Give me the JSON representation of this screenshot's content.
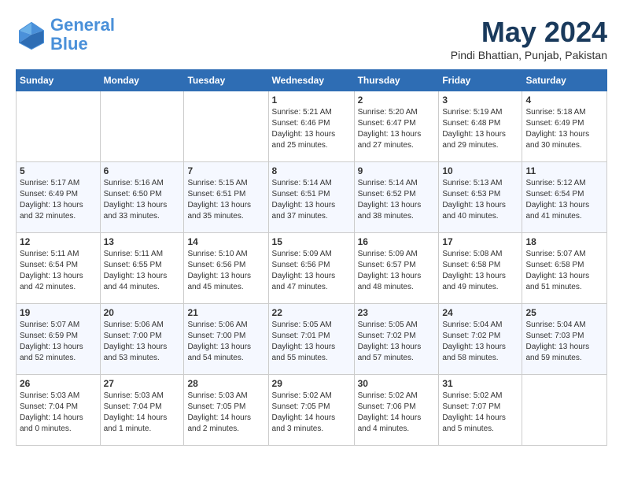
{
  "header": {
    "logo_line1": "General",
    "logo_line2": "Blue",
    "month_title": "May 2024",
    "location": "Pindi Bhattian, Punjab, Pakistan"
  },
  "days_of_week": [
    "Sunday",
    "Monday",
    "Tuesday",
    "Wednesday",
    "Thursday",
    "Friday",
    "Saturday"
  ],
  "weeks": [
    [
      {
        "num": "",
        "sunrise": "",
        "sunset": "",
        "daylight": ""
      },
      {
        "num": "",
        "sunrise": "",
        "sunset": "",
        "daylight": ""
      },
      {
        "num": "",
        "sunrise": "",
        "sunset": "",
        "daylight": ""
      },
      {
        "num": "1",
        "sunrise": "Sunrise: 5:21 AM",
        "sunset": "Sunset: 6:46 PM",
        "daylight": "Daylight: 13 hours and 25 minutes."
      },
      {
        "num": "2",
        "sunrise": "Sunrise: 5:20 AM",
        "sunset": "Sunset: 6:47 PM",
        "daylight": "Daylight: 13 hours and 27 minutes."
      },
      {
        "num": "3",
        "sunrise": "Sunrise: 5:19 AM",
        "sunset": "Sunset: 6:48 PM",
        "daylight": "Daylight: 13 hours and 29 minutes."
      },
      {
        "num": "4",
        "sunrise": "Sunrise: 5:18 AM",
        "sunset": "Sunset: 6:49 PM",
        "daylight": "Daylight: 13 hours and 30 minutes."
      }
    ],
    [
      {
        "num": "5",
        "sunrise": "Sunrise: 5:17 AM",
        "sunset": "Sunset: 6:49 PM",
        "daylight": "Daylight: 13 hours and 32 minutes."
      },
      {
        "num": "6",
        "sunrise": "Sunrise: 5:16 AM",
        "sunset": "Sunset: 6:50 PM",
        "daylight": "Daylight: 13 hours and 33 minutes."
      },
      {
        "num": "7",
        "sunrise": "Sunrise: 5:15 AM",
        "sunset": "Sunset: 6:51 PM",
        "daylight": "Daylight: 13 hours and 35 minutes."
      },
      {
        "num": "8",
        "sunrise": "Sunrise: 5:14 AM",
        "sunset": "Sunset: 6:51 PM",
        "daylight": "Daylight: 13 hours and 37 minutes."
      },
      {
        "num": "9",
        "sunrise": "Sunrise: 5:14 AM",
        "sunset": "Sunset: 6:52 PM",
        "daylight": "Daylight: 13 hours and 38 minutes."
      },
      {
        "num": "10",
        "sunrise": "Sunrise: 5:13 AM",
        "sunset": "Sunset: 6:53 PM",
        "daylight": "Daylight: 13 hours and 40 minutes."
      },
      {
        "num": "11",
        "sunrise": "Sunrise: 5:12 AM",
        "sunset": "Sunset: 6:54 PM",
        "daylight": "Daylight: 13 hours and 41 minutes."
      }
    ],
    [
      {
        "num": "12",
        "sunrise": "Sunrise: 5:11 AM",
        "sunset": "Sunset: 6:54 PM",
        "daylight": "Daylight: 13 hours and 42 minutes."
      },
      {
        "num": "13",
        "sunrise": "Sunrise: 5:11 AM",
        "sunset": "Sunset: 6:55 PM",
        "daylight": "Daylight: 13 hours and 44 minutes."
      },
      {
        "num": "14",
        "sunrise": "Sunrise: 5:10 AM",
        "sunset": "Sunset: 6:56 PM",
        "daylight": "Daylight: 13 hours and 45 minutes."
      },
      {
        "num": "15",
        "sunrise": "Sunrise: 5:09 AM",
        "sunset": "Sunset: 6:56 PM",
        "daylight": "Daylight: 13 hours and 47 minutes."
      },
      {
        "num": "16",
        "sunrise": "Sunrise: 5:09 AM",
        "sunset": "Sunset: 6:57 PM",
        "daylight": "Daylight: 13 hours and 48 minutes."
      },
      {
        "num": "17",
        "sunrise": "Sunrise: 5:08 AM",
        "sunset": "Sunset: 6:58 PM",
        "daylight": "Daylight: 13 hours and 49 minutes."
      },
      {
        "num": "18",
        "sunrise": "Sunrise: 5:07 AM",
        "sunset": "Sunset: 6:58 PM",
        "daylight": "Daylight: 13 hours and 51 minutes."
      }
    ],
    [
      {
        "num": "19",
        "sunrise": "Sunrise: 5:07 AM",
        "sunset": "Sunset: 6:59 PM",
        "daylight": "Daylight: 13 hours and 52 minutes."
      },
      {
        "num": "20",
        "sunrise": "Sunrise: 5:06 AM",
        "sunset": "Sunset: 7:00 PM",
        "daylight": "Daylight: 13 hours and 53 minutes."
      },
      {
        "num": "21",
        "sunrise": "Sunrise: 5:06 AM",
        "sunset": "Sunset: 7:00 PM",
        "daylight": "Daylight: 13 hours and 54 minutes."
      },
      {
        "num": "22",
        "sunrise": "Sunrise: 5:05 AM",
        "sunset": "Sunset: 7:01 PM",
        "daylight": "Daylight: 13 hours and 55 minutes."
      },
      {
        "num": "23",
        "sunrise": "Sunrise: 5:05 AM",
        "sunset": "Sunset: 7:02 PM",
        "daylight": "Daylight: 13 hours and 57 minutes."
      },
      {
        "num": "24",
        "sunrise": "Sunrise: 5:04 AM",
        "sunset": "Sunset: 7:02 PM",
        "daylight": "Daylight: 13 hours and 58 minutes."
      },
      {
        "num": "25",
        "sunrise": "Sunrise: 5:04 AM",
        "sunset": "Sunset: 7:03 PM",
        "daylight": "Daylight: 13 hours and 59 minutes."
      }
    ],
    [
      {
        "num": "26",
        "sunrise": "Sunrise: 5:03 AM",
        "sunset": "Sunset: 7:04 PM",
        "daylight": "Daylight: 14 hours and 0 minutes."
      },
      {
        "num": "27",
        "sunrise": "Sunrise: 5:03 AM",
        "sunset": "Sunset: 7:04 PM",
        "daylight": "Daylight: 14 hours and 1 minute."
      },
      {
        "num": "28",
        "sunrise": "Sunrise: 5:03 AM",
        "sunset": "Sunset: 7:05 PM",
        "daylight": "Daylight: 14 hours and 2 minutes."
      },
      {
        "num": "29",
        "sunrise": "Sunrise: 5:02 AM",
        "sunset": "Sunset: 7:05 PM",
        "daylight": "Daylight: 14 hours and 3 minutes."
      },
      {
        "num": "30",
        "sunrise": "Sunrise: 5:02 AM",
        "sunset": "Sunset: 7:06 PM",
        "daylight": "Daylight: 14 hours and 4 minutes."
      },
      {
        "num": "31",
        "sunrise": "Sunrise: 5:02 AM",
        "sunset": "Sunset: 7:07 PM",
        "daylight": "Daylight: 14 hours and 5 minutes."
      },
      {
        "num": "",
        "sunrise": "",
        "sunset": "",
        "daylight": ""
      }
    ]
  ]
}
